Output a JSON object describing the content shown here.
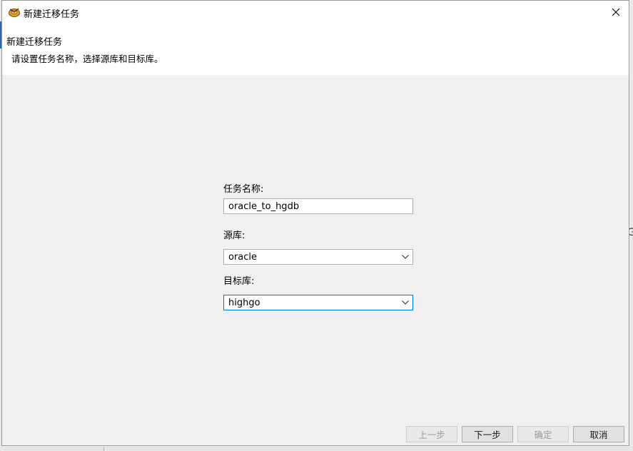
{
  "window": {
    "title": "新建迁移任务"
  },
  "header": {
    "title": "新建迁移任务",
    "description": "请设置任务名称，选择源库和目标库。"
  },
  "form": {
    "task_name": {
      "label": "任务名称:",
      "value": "oracle_to_hgdb"
    },
    "source_db": {
      "label": "源库:",
      "value": "oracle"
    },
    "target_db": {
      "label": "目标库:",
      "value": "highgo"
    }
  },
  "buttons": {
    "prev": "上一步",
    "next": "下一步",
    "confirm": "确定",
    "cancel": "取消"
  },
  "background": {
    "right_glyph": "G"
  },
  "colors": {
    "focus_border": "#0078d7",
    "dialog_bg": "#f0f0f0"
  }
}
